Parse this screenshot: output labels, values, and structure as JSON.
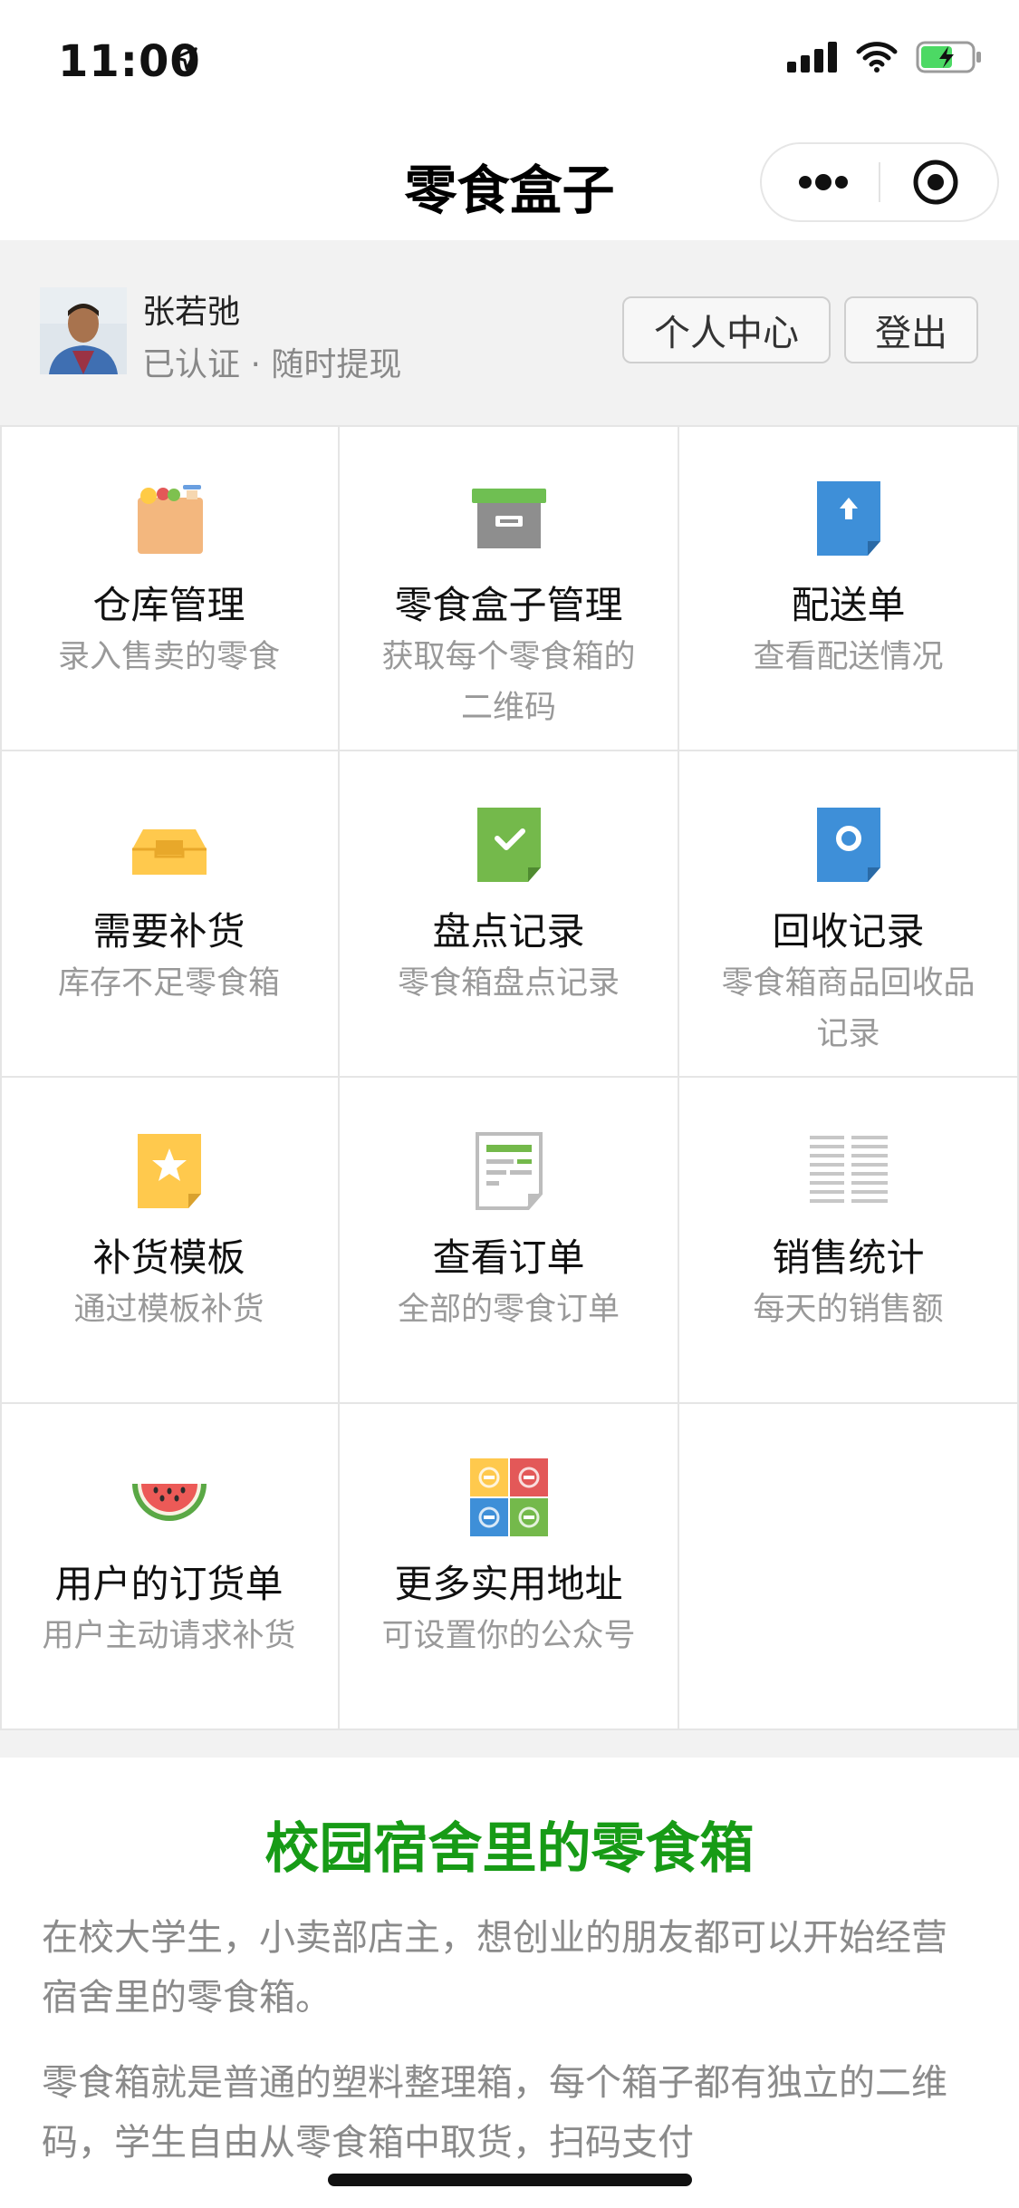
{
  "status_bar": {
    "time": "11:00"
  },
  "nav": {
    "title": "零食盒子"
  },
  "user": {
    "name": "张若弛",
    "subtitle": "已认证 · 随时提现",
    "center_button": "个人中心",
    "logout_button": "登出"
  },
  "menu": [
    {
      "icon": "shopping-bag-icon",
      "title": "仓库管理",
      "desc": "录入售卖的零食"
    },
    {
      "icon": "storage-box-icon",
      "title": "零食盒子管理",
      "desc": "获取每个零食箱的二维码"
    },
    {
      "icon": "upload-document-icon",
      "title": "配送单",
      "desc": "查看配送情况"
    },
    {
      "icon": "inbox-tray-icon",
      "title": "需要补货",
      "desc": "库存不足零食箱"
    },
    {
      "icon": "checklist-document-icon",
      "title": "盘点记录",
      "desc": "零食箱盘点记录"
    },
    {
      "icon": "recycle-document-icon",
      "title": "回收记录",
      "desc": "零食箱商品回收品记录"
    },
    {
      "icon": "star-document-icon",
      "title": "补货模板",
      "desc": "通过模板补货"
    },
    {
      "icon": "receipt-icon",
      "title": "查看订单",
      "desc": "全部的零食订单"
    },
    {
      "icon": "stats-list-icon",
      "title": "销售统计",
      "desc": "每天的销售额"
    },
    {
      "icon": "watermelon-icon",
      "title": "用户的订货单",
      "desc": "用户主动请求补货"
    },
    {
      "icon": "color-grid-icon",
      "title": "更多实用地址",
      "desc": "可设置你的公众号"
    }
  ],
  "article": {
    "title": "校园宿舍里的零食箱",
    "p1": "在校大学生，小卖部店主，想创业的朋友都可以开始经营宿舍里的零食箱。",
    "p2": "零食箱就是普通的塑料整理箱，每个箱子都有独立的二维码，学生自由从零食箱中取货，扫码支付"
  },
  "colors": {
    "accent_green": "#179b16",
    "background_gray": "#f2f2f2"
  }
}
